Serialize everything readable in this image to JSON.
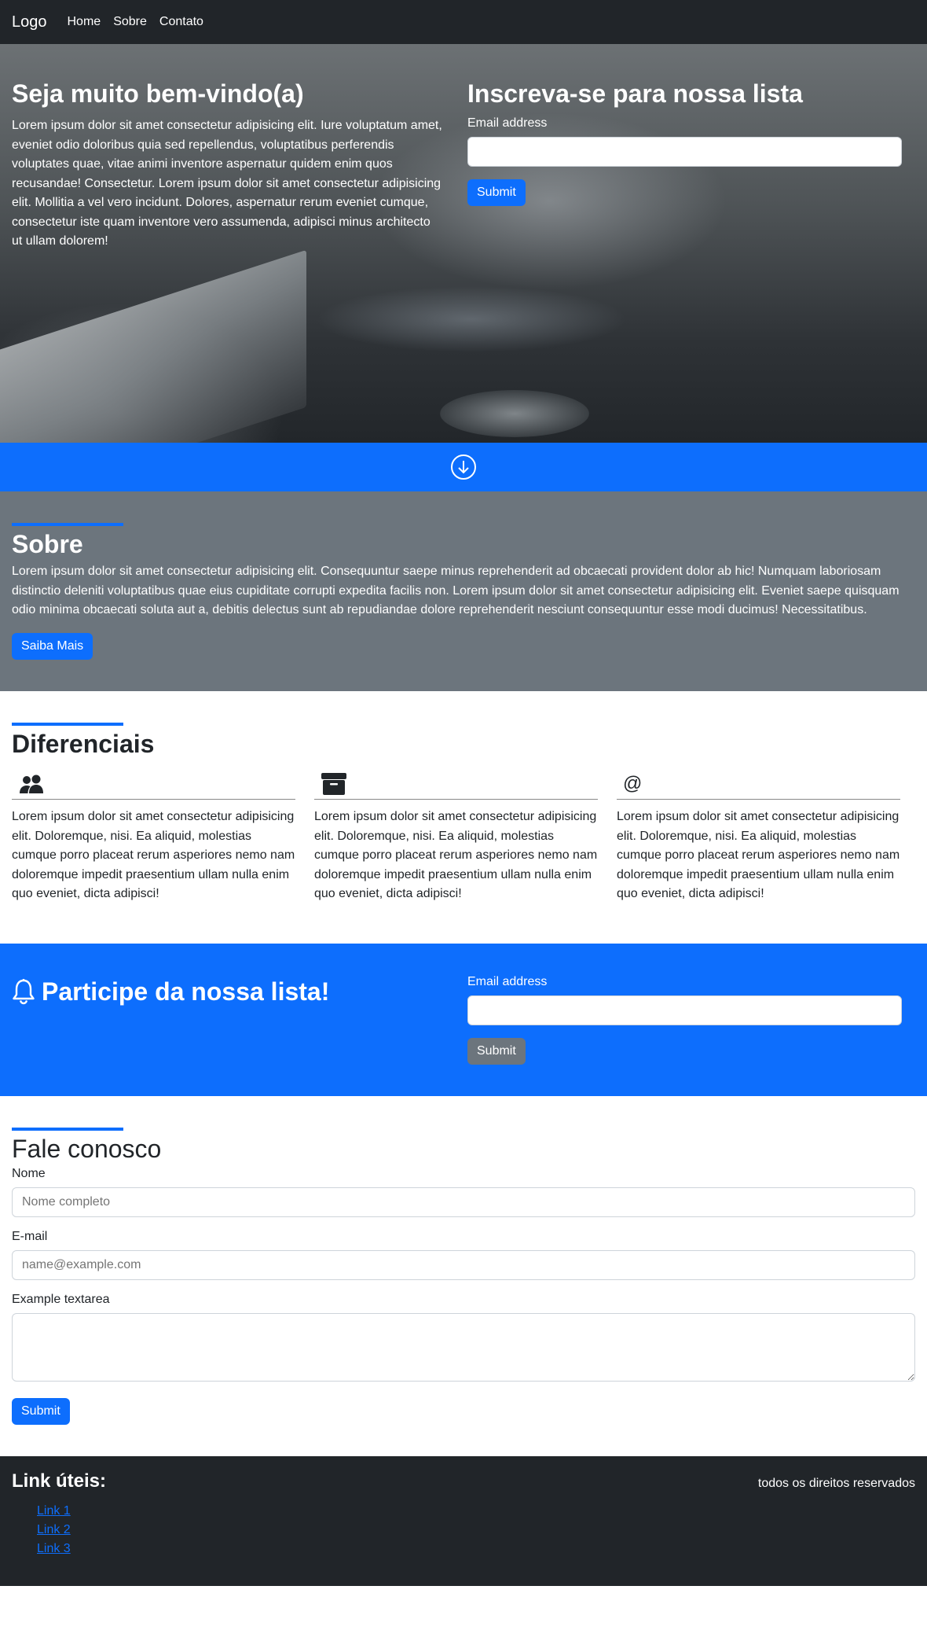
{
  "navbar": {
    "brand": "Logo",
    "links": [
      "Home",
      "Sobre",
      "Contato"
    ]
  },
  "hero": {
    "title": "Seja muito bem-vindo(a)",
    "text": "Lorem ipsum dolor sit amet consectetur adipisicing elit. Iure voluptatum amet, eveniet odio doloribus quia sed repellendus, voluptatibus perferendis voluptates quae, vitae animi inventore aspernatur quidem enim quos recusandae! Consectetur. Lorem ipsum dolor sit amet consectetur adipisicing elit. Mollitia a vel vero incidunt. Dolores, aspernatur rerum eveniet cumque, consectetur iste quam inventore vero assumenda, adipisci minus architecto ut ullam dolorem!",
    "form_title": "Inscreva-se para nossa lista",
    "email_label": "Email address",
    "email_value": "",
    "submit_label": "Submit"
  },
  "arrow_icon": "arrow-down-circle-icon",
  "sobre": {
    "title": "Sobre",
    "text": "Lorem ipsum dolor sit amet consectetur adipisicing elit. Consequuntur saepe minus reprehenderit ad obcaecati provident dolor ab hic! Numquam laboriosam distinctio deleniti voluptatibus quae eius cupiditate corrupti expedita facilis non. Lorem ipsum dolor sit amet consectetur adipisicing elit. Eveniet saepe quisquam odio minima obcaecati soluta aut a, debitis delectus sunt ab repudiandae dolore reprehenderit nesciunt consequuntur esse modi ducimus! Necessitatibus.",
    "button_label": "Saiba Mais"
  },
  "diferenciais": {
    "title": "Diferenciais",
    "items": [
      {
        "icon": "people-icon",
        "text": "Lorem ipsum dolor sit amet consectetur adipisicing elit. Doloremque, nisi. Ea aliquid, molestias cumque porro placeat rerum asperiores nemo nam doloremque impedit praesentium ullam nulla enim quo eveniet, dicta adipisci!"
      },
      {
        "icon": "archive-icon",
        "text": "Lorem ipsum dolor sit amet consectetur adipisicing elit. Doloremque, nisi. Ea aliquid, molestias cumque porro placeat rerum asperiores nemo nam doloremque impedit praesentium ullam nulla enim quo eveniet, dicta adipisci!"
      },
      {
        "icon": "at-icon",
        "icon_glyph": "@",
        "text": "Lorem ipsum dolor sit amet consectetur adipisicing elit. Doloremque, nisi. Ea aliquid, molestias cumque porro placeat rerum asperiores nemo nam doloremque impedit praesentium ullam nulla enim quo eveniet, dicta adipisci!"
      }
    ]
  },
  "newsletter": {
    "icon": "bell-icon",
    "title": "Participe da nossa lista!",
    "email_label": "Email address",
    "email_value": "",
    "submit_label": "Submit"
  },
  "contato": {
    "title": "Fale conosco",
    "nome_label": "Nome",
    "nome_placeholder": "Nome completo",
    "email_label": "E-mail",
    "email_placeholder": "name@example.com",
    "textarea_label": "Example textarea",
    "submit_label": "Submit"
  },
  "footer": {
    "title": "Link úteis:",
    "links": [
      "Link 1",
      "Link 2",
      "Link 3"
    ],
    "rights": "todos os direitos reservados"
  },
  "colors": {
    "primary": "#0d6efd",
    "dark": "#212529",
    "secondary": "#6c757d"
  }
}
